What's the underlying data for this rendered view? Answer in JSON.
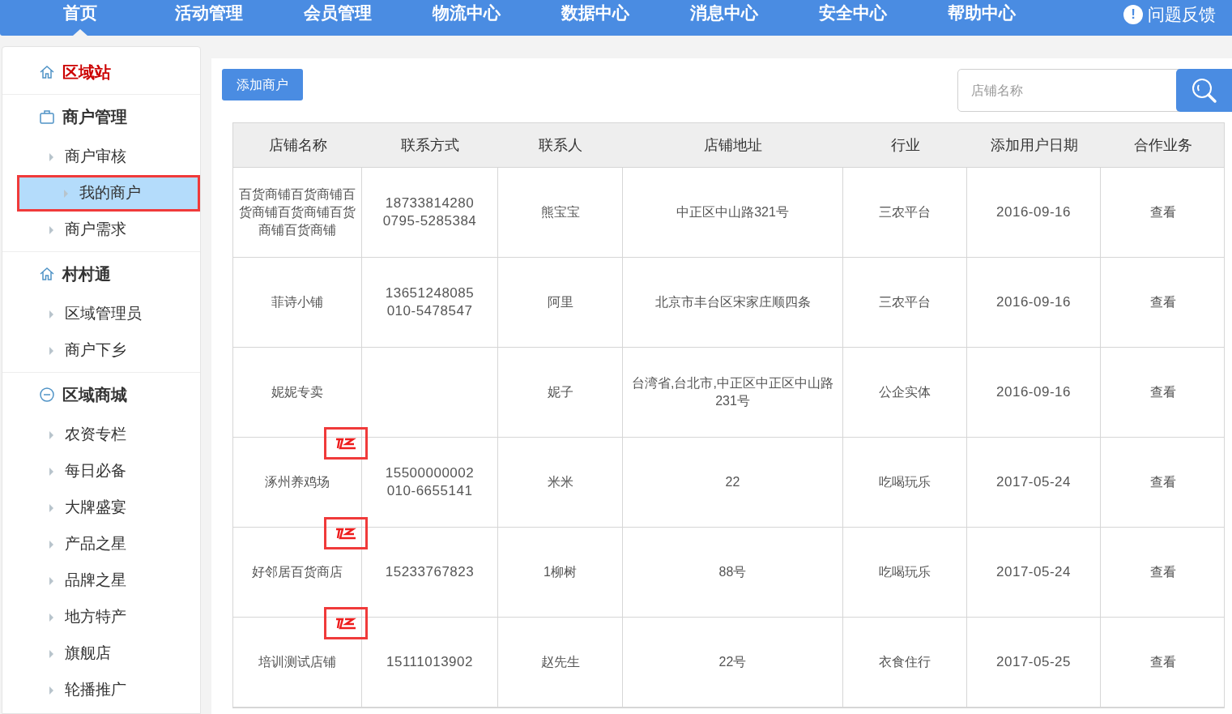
{
  "nav": [
    {
      "label": "首页",
      "selected": true
    },
    {
      "label": "活动管理",
      "selected": false
    },
    {
      "label": "会员管理",
      "selected": false
    },
    {
      "label": "物流中心",
      "selected": false
    },
    {
      "label": "数据中心",
      "selected": false
    },
    {
      "label": "消息中心",
      "selected": false
    },
    {
      "label": "安全中心",
      "selected": false
    },
    {
      "label": "帮助中心",
      "selected": false
    }
  ],
  "feedback": {
    "label": "问题反馈",
    "icon": "!"
  },
  "sidebar": [
    {
      "title": "区域站",
      "kind": "home",
      "accent": true
    },
    {
      "title": "商户管理",
      "kind": "bag",
      "accent": false,
      "items": [
        {
          "label": "商户审核",
          "selected": false,
          "highlighted": false
        },
        {
          "label": "我的商户",
          "selected": true,
          "highlighted": true
        },
        {
          "label": "商户需求",
          "selected": false,
          "highlighted": false
        }
      ]
    },
    {
      "title": "村村通",
      "kind": "home",
      "accent": false,
      "items": [
        {
          "label": "区域管理员",
          "selected": false,
          "highlighted": false
        },
        {
          "label": "商户下乡",
          "selected": false,
          "highlighted": false
        }
      ]
    },
    {
      "title": "区域商城",
      "kind": "circle",
      "accent": false,
      "items": [
        {
          "label": "农资专栏",
          "selected": false,
          "highlighted": false
        },
        {
          "label": "每日必备",
          "selected": false,
          "highlighted": false
        },
        {
          "label": "大牌盛宴",
          "selected": false,
          "highlighted": false
        },
        {
          "label": "产品之星",
          "selected": false,
          "highlighted": false
        },
        {
          "label": "品牌之星",
          "selected": false,
          "highlighted": false
        },
        {
          "label": "地方特产",
          "selected": false,
          "highlighted": false
        },
        {
          "label": "旗舰店",
          "selected": false,
          "highlighted": false
        },
        {
          "label": "轮播推广",
          "selected": false,
          "highlighted": false
        }
      ]
    }
  ],
  "add_button": "添加商户",
  "search": {
    "placeholder": "店铺名称"
  },
  "table": {
    "columns": [
      "店铺名称",
      "联系方式",
      "联系人",
      "店铺地址",
      "行业",
      "添加用户日期",
      "合作业务"
    ],
    "rows": [
      {
        "name": "百货商铺百货商铺百货商铺百货商铺百货商铺百货商铺",
        "phones": [
          "18733814280",
          "0795-5285384"
        ],
        "contact": "熊宝宝",
        "address": "中正区中山路321号",
        "industry": "三农平台",
        "date": "2016-09-16",
        "action": "查看",
        "badge": false
      },
      {
        "name": "菲诗小铺",
        "phones": [
          "13651248085",
          "010-5478547"
        ],
        "contact": "阿里",
        "address": "北京市丰台区宋家庄顺四条",
        "industry": "三农平台",
        "date": "2016-09-16",
        "action": "查看",
        "badge": false
      },
      {
        "name": "妮妮专卖",
        "phones": [],
        "contact": "妮子",
        "address": "台湾省,台北市,中正区中正区中山路231号",
        "industry": "公企实体",
        "date": "2016-09-16",
        "action": "查看",
        "badge": false
      },
      {
        "name": "涿州养鸡场",
        "phones": [
          "15500000002",
          "010-6655141"
        ],
        "contact": "米米",
        "address": "22",
        "industry": "吃喝玩乐",
        "date": "2017-05-24",
        "action": "查看",
        "badge": true
      },
      {
        "name": "好邻居百货商店",
        "phones": [
          "15233767823"
        ],
        "contact": "1柳树",
        "address": "88号",
        "industry": "吃喝玩乐",
        "date": "2017-05-24",
        "action": "查看",
        "badge": true
      },
      {
        "name": "培训测试店铺",
        "phones": [
          "15111013902"
        ],
        "contact": "赵先生",
        "address": "22号",
        "industry": "衣食住行",
        "date": "2017-05-25",
        "action": "查看",
        "badge": true
      }
    ]
  }
}
